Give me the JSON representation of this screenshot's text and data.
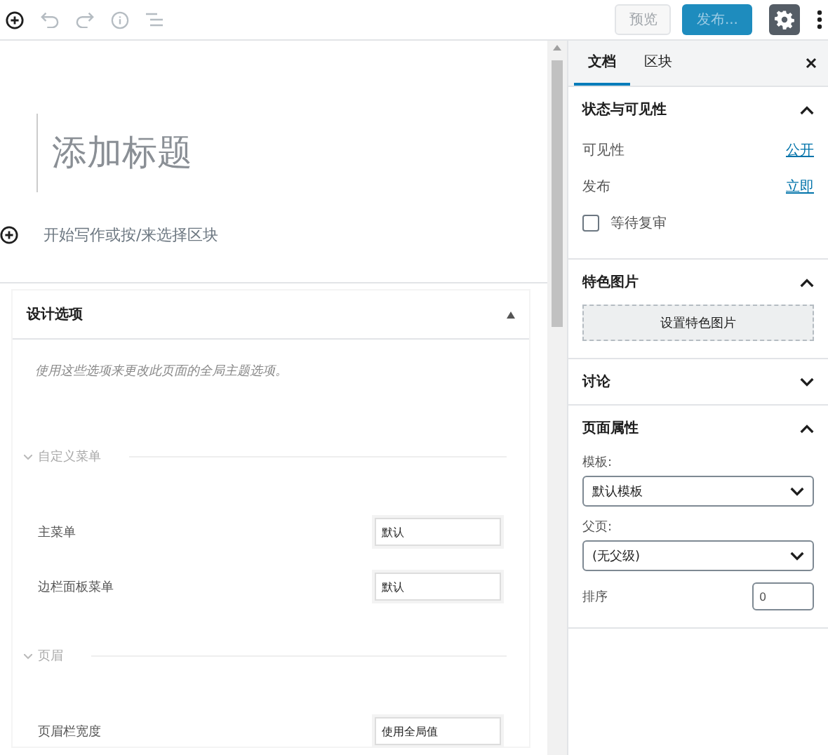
{
  "toolbar": {
    "preview": "预览",
    "publish": "发布..."
  },
  "editor": {
    "title_placeholder": "添加标题",
    "appender_placeholder": "开始写作或按/来选择区块"
  },
  "metabox": {
    "title": "设计选项",
    "expanded": true,
    "description": "使用这些选项来更改此页面的全局主题选项。",
    "sections": [
      {
        "title": "自定义菜单",
        "rows": [
          {
            "label": "主菜单",
            "value": "默认"
          },
          {
            "label": "边栏面板菜单",
            "value": "默认"
          }
        ]
      },
      {
        "title": "页眉",
        "rows": [
          {
            "label": "页眉栏宽度",
            "value": "使用全局值"
          }
        ]
      }
    ]
  },
  "sidebar": {
    "tabs": [
      {
        "label": "文档",
        "selected": true
      },
      {
        "label": "区块",
        "selected": false
      }
    ],
    "panels": [
      {
        "kind": "status",
        "title": "状态与可见性",
        "expanded": true,
        "rows": [
          {
            "label": "可见性",
            "link": "公开"
          },
          {
            "label": "发布",
            "link": "立即"
          }
        ],
        "checkbox": {
          "label": "等待复审",
          "checked": false
        }
      },
      {
        "kind": "image",
        "title": "特色图片",
        "expanded": true,
        "button": "设置特色图片"
      },
      {
        "title": "讨论",
        "expanded": false
      },
      {
        "kind": "attributes",
        "title": "页面属性",
        "expanded": true,
        "selects": [
          {
            "label": "模板:",
            "value": "默认模板"
          },
          {
            "label": "父页:",
            "value": "(无父级)"
          }
        ],
        "order": {
          "label": "排序",
          "value": "0"
        }
      }
    ]
  }
}
